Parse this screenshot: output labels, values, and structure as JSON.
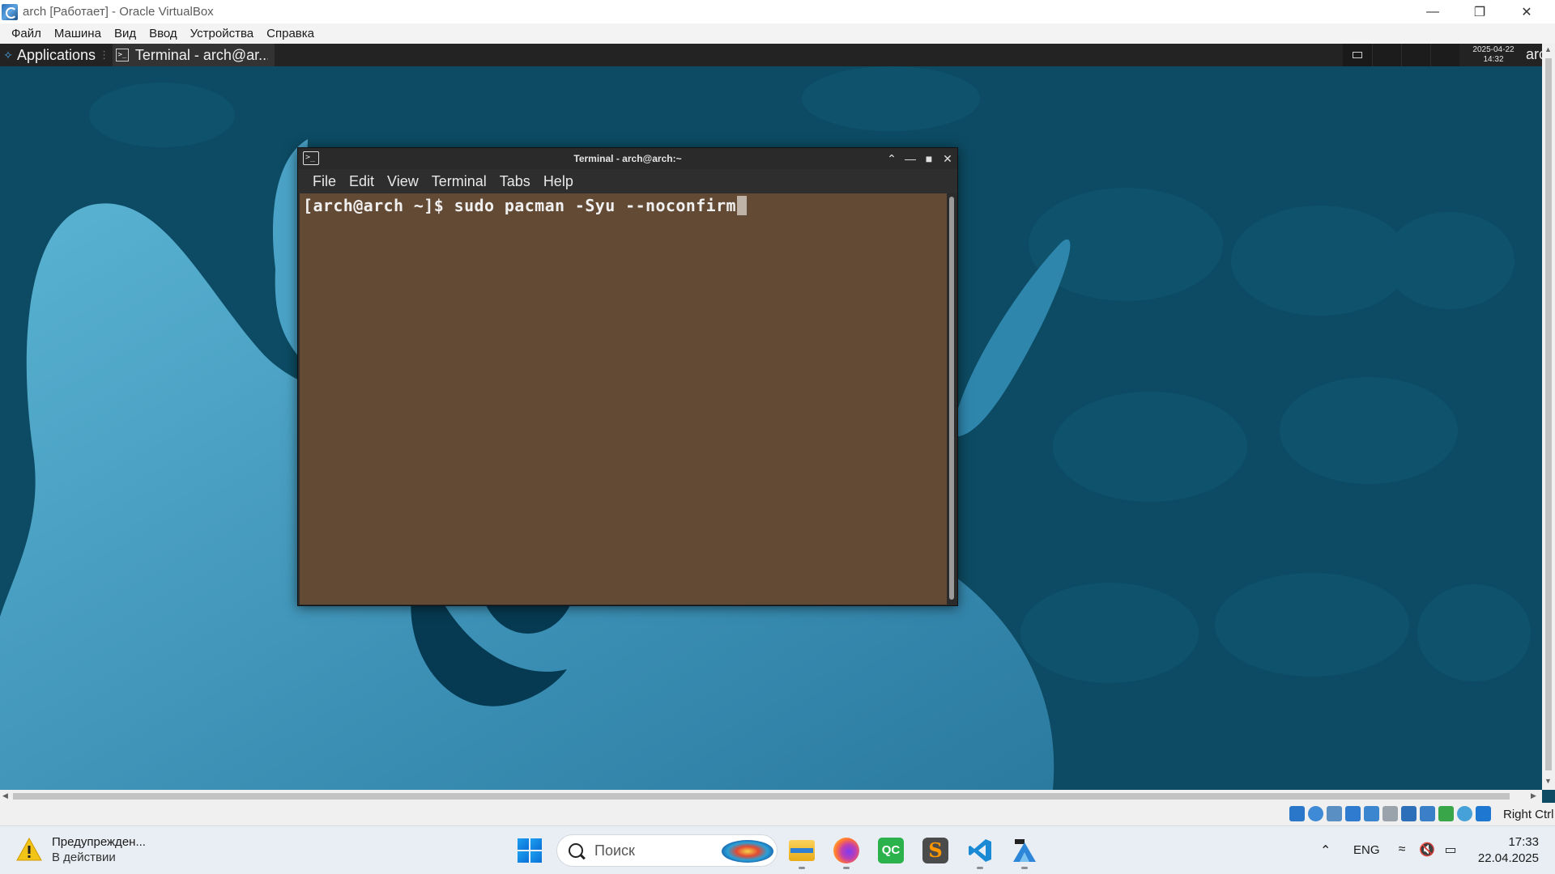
{
  "vbox": {
    "title": "arch [Работает] - Oracle VirtualBox",
    "menu": [
      "Файл",
      "Машина",
      "Вид",
      "Ввод",
      "Устройства",
      "Справка"
    ],
    "status_host_key": "Right Ctrl"
  },
  "guest_panel": {
    "applications_label": "Applications",
    "task_label": "Terminal - arch@ar...",
    "clock_date": "2025-04-22",
    "clock_time": "14:32",
    "user_label": "arc"
  },
  "terminal": {
    "title": "Terminal - arch@arch:~",
    "menu": [
      "File",
      "Edit",
      "View",
      "Terminal",
      "Tabs",
      "Help"
    ],
    "prompt": "[arch@arch ~]$ ",
    "command": "sudo pacman -Syu --noconfirm",
    "background_color": "#634a35"
  },
  "windows_taskbar": {
    "weather_title": "Предупрежден...",
    "weather_subtitle": "В действии",
    "search_placeholder": "Поиск",
    "apps": [
      "file-explorer",
      "firefox",
      "qcad",
      "sublime-text",
      "vscode",
      "virtualbox"
    ],
    "language": "ENG",
    "time": "17:33",
    "date": "22.04.2025"
  },
  "colors": {
    "desktop_bg": "#0c4b63",
    "accent_light_blue": "#4fa3c2",
    "windows_accent": "#0a6fd6"
  }
}
